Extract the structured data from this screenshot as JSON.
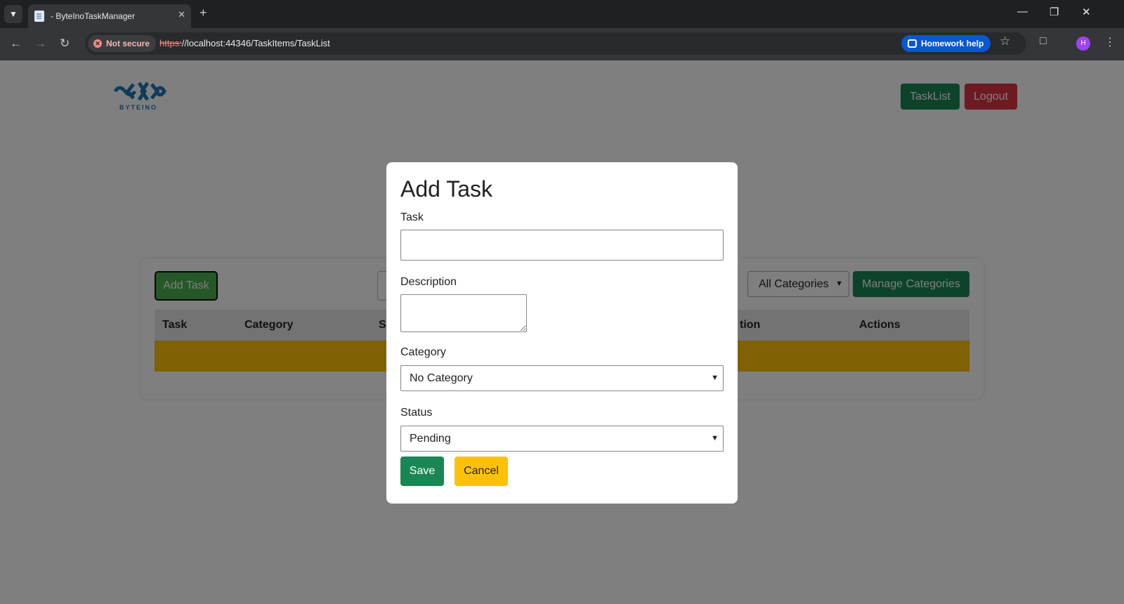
{
  "browser": {
    "tab_title": "- ByteInoTaskManager",
    "new_tab": "+",
    "security_label": "Not secure",
    "url_scheme": "https:",
    "url_rest": "//localhost:44346/TaskItems/TaskList",
    "homework_help": "Homework help",
    "avatar_letter": "H"
  },
  "header": {
    "logo_text": "BYTEINO",
    "tasklist_label": "TaskList",
    "logout_label": "Logout"
  },
  "toolbar": {
    "add_task_label": "Add Task",
    "category_filter_value": "All Categories",
    "manage_categories_label": "Manage Categories"
  },
  "table": {
    "columns": [
      "Task",
      "Category",
      "S",
      "tion",
      "Actions"
    ]
  },
  "modal": {
    "title": "Add Task",
    "task_label": "Task",
    "task_value": "",
    "description_label": "Description",
    "description_value": "",
    "category_label": "Category",
    "category_value": "No Category",
    "status_label": "Status",
    "status_value": "Pending",
    "save_label": "Save",
    "cancel_label": "Cancel"
  },
  "colors": {
    "success": "#198754",
    "danger": "#dc3545",
    "warning": "#ffc107",
    "add_task_green": "#4caf50",
    "overlay": "rgba(0,0,0,0.5)"
  }
}
